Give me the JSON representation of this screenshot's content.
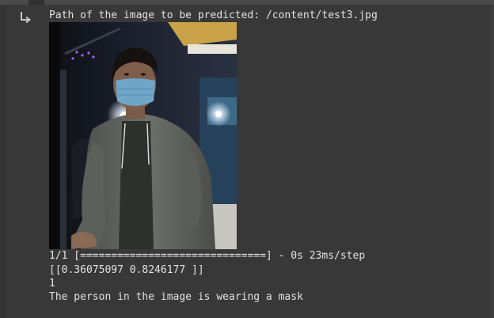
{
  "output": {
    "icon": "output-redirect-icon",
    "image_path_line": "Path of the image to be predicted: /content/test3.jpg",
    "image_alt": "Prediction input photo: person wearing a blue face mask",
    "progress_line": "1/1 [==============================] - 0s 23ms/step",
    "probabilities_line": "[[0.36075097 0.8246177 ]]",
    "predicted_class_line": "1",
    "verdict_line": "The person in the image is wearing a mask"
  },
  "colors": {
    "background": "#383838",
    "text": "#e2e2e2",
    "mask": "#6fa6c8"
  }
}
